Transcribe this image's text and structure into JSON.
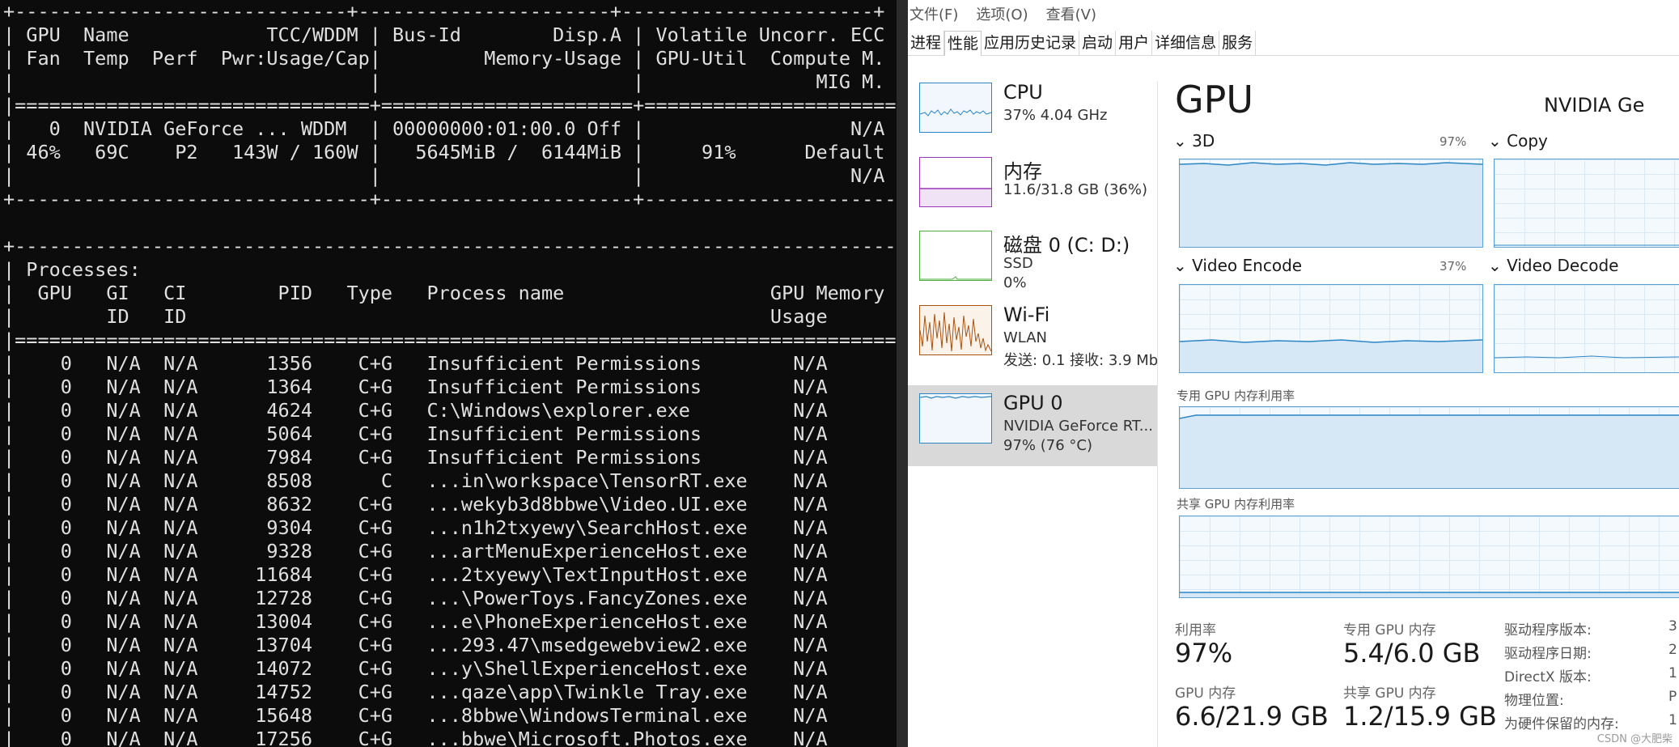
{
  "terminal": {
    "lines": [
      "+-----------------------------+----------------------+----------------------+",
      "| GPU  Name            TCC/WDDM | Bus-Id        Disp.A | Volatile Uncorr. ECC |",
      "| Fan  Temp  Perf  Pwr:Usage/Cap|         Memory-Usage | GPU-Util  Compute M. |",
      "|                               |                      |               MIG M. |",
      "|===============================+======================+======================|",
      "|   0  NVIDIA GeForce ... WDDM  | 00000000:01:00.0 Off |                  N/A |",
      "| 46%   69C    P2   143W / 160W |   5645MiB /  6144MiB |     91%      Default |",
      "|                               |                      |                  N/A |",
      "+-------------------------------+----------------------+----------------------+",
      "",
      "+-----------------------------------------------------------------------------+",
      "| Processes:                                                                  |",
      "|  GPU   GI   CI        PID   Type   Process name                  GPU Memory |",
      "|        ID   ID                                                   Usage      |",
      "|=============================================================================|",
      "|    0   N/A  N/A      1356    C+G   Insufficient Permissions        N/A      |",
      "|    0   N/A  N/A      1364    C+G   Insufficient Permissions        N/A      |",
      "|    0   N/A  N/A      4624    C+G   C:\\Windows\\explorer.exe         N/A      |",
      "|    0   N/A  N/A      5064    C+G   Insufficient Permissions        N/A      |",
      "|    0   N/A  N/A      7984    C+G   Insufficient Permissions        N/A      |",
      "|    0   N/A  N/A      8508      C   ...in\\workspace\\TensorRT.exe    N/A      |",
      "|    0   N/A  N/A      8632    C+G   ...wekyb3d8bbwe\\Video.UI.exe    N/A      |",
      "|    0   N/A  N/A      9304    C+G   ...n1h2txyewy\\SearchHost.exe    N/A      |",
      "|    0   N/A  N/A      9328    C+G   ...artMenuExperienceHost.exe    N/A      |",
      "|    0   N/A  N/A     11684    C+G   ...2txyewy\\TextInputHost.exe    N/A      |",
      "|    0   N/A  N/A     12728    C+G   ...\\PowerToys.FancyZones.exe    N/A      |",
      "|    0   N/A  N/A     13004    C+G   ...e\\PhoneExperienceHost.exe    N/A      |",
      "|    0   N/A  N/A     13704    C+G   ...293.47\\msedgewebview2.exe    N/A      |",
      "|    0   N/A  N/A     14072    C+G   ...y\\ShellExperienceHost.exe    N/A      |",
      "|    0   N/A  N/A     14752    C+G   ...qaze\\app\\Twinkle Tray.exe    N/A      |",
      "|    0   N/A  N/A     15648    C+G   ...8bbwe\\WindowsTerminal.exe    N/A      |",
      "|    0   N/A  N/A     17256    C+G   ...bbwe\\Microsoft.Photos.exe    N/A      |"
    ]
  },
  "taskmgr": {
    "menu": [
      "文件(F)",
      "选项(O)",
      "查看(V)"
    ],
    "tabs": [
      "进程",
      "性能",
      "应用历史记录",
      "启动",
      "用户",
      "详细信息",
      "服务"
    ],
    "sidebar": [
      {
        "name": "CPU",
        "sub1": "37%  4.04 GHz",
        "sub2": "",
        "color": "#2b86c6"
      },
      {
        "name": "内存",
        "sub1": "11.6/31.8 GB (36%)",
        "sub2": "",
        "color": "#9b36b7"
      },
      {
        "name": "磁盘 0 (C: D:)",
        "sub1": "SSD",
        "sub2": "0%",
        "color": "#4caf3c"
      },
      {
        "name": "Wi-Fi",
        "sub1": "WLAN",
        "sub2": "发送: 0.1  接收: 3.9 Mb",
        "color": "#a9520f"
      },
      {
        "name": "GPU 0",
        "sub1": "NVIDIA GeForce RT...",
        "sub2": "97%  (76 °C)",
        "color": "#2b86c6"
      }
    ],
    "gpu": {
      "title": "GPU",
      "name": "NVIDIA Ge",
      "engines": [
        {
          "label": "3D",
          "pct": "97%"
        },
        {
          "label": "Copy",
          "pct": ""
        },
        {
          "label": "Video Encode",
          "pct": "37%"
        },
        {
          "label": "Video Decode",
          "pct": ""
        }
      ],
      "dedicated_label": "专用 GPU 内存利用率",
      "shared_label": "共享 GPU 内存利用率",
      "stats": [
        {
          "label": "利用率",
          "value": "97%"
        },
        {
          "label": "专用 GPU 内存",
          "value": "5.4/6.0 GB"
        },
        {
          "label": "GPU 内存",
          "value": "6.6/21.9 GB"
        },
        {
          "label": "共享 GPU 内存",
          "value": "1.2/15.9 GB"
        }
      ],
      "info": [
        {
          "k": "驱动程序版本:",
          "v": "3"
        },
        {
          "k": "驱动程序日期:",
          "v": "2"
        },
        {
          "k": "DirectX 版本:",
          "v": "1"
        },
        {
          "k": "物理位置:",
          "v": "P"
        },
        {
          "k": "为硬件保留的内存:",
          "v": "1"
        }
      ]
    },
    "watermark": "CSDN @大肥柴"
  }
}
